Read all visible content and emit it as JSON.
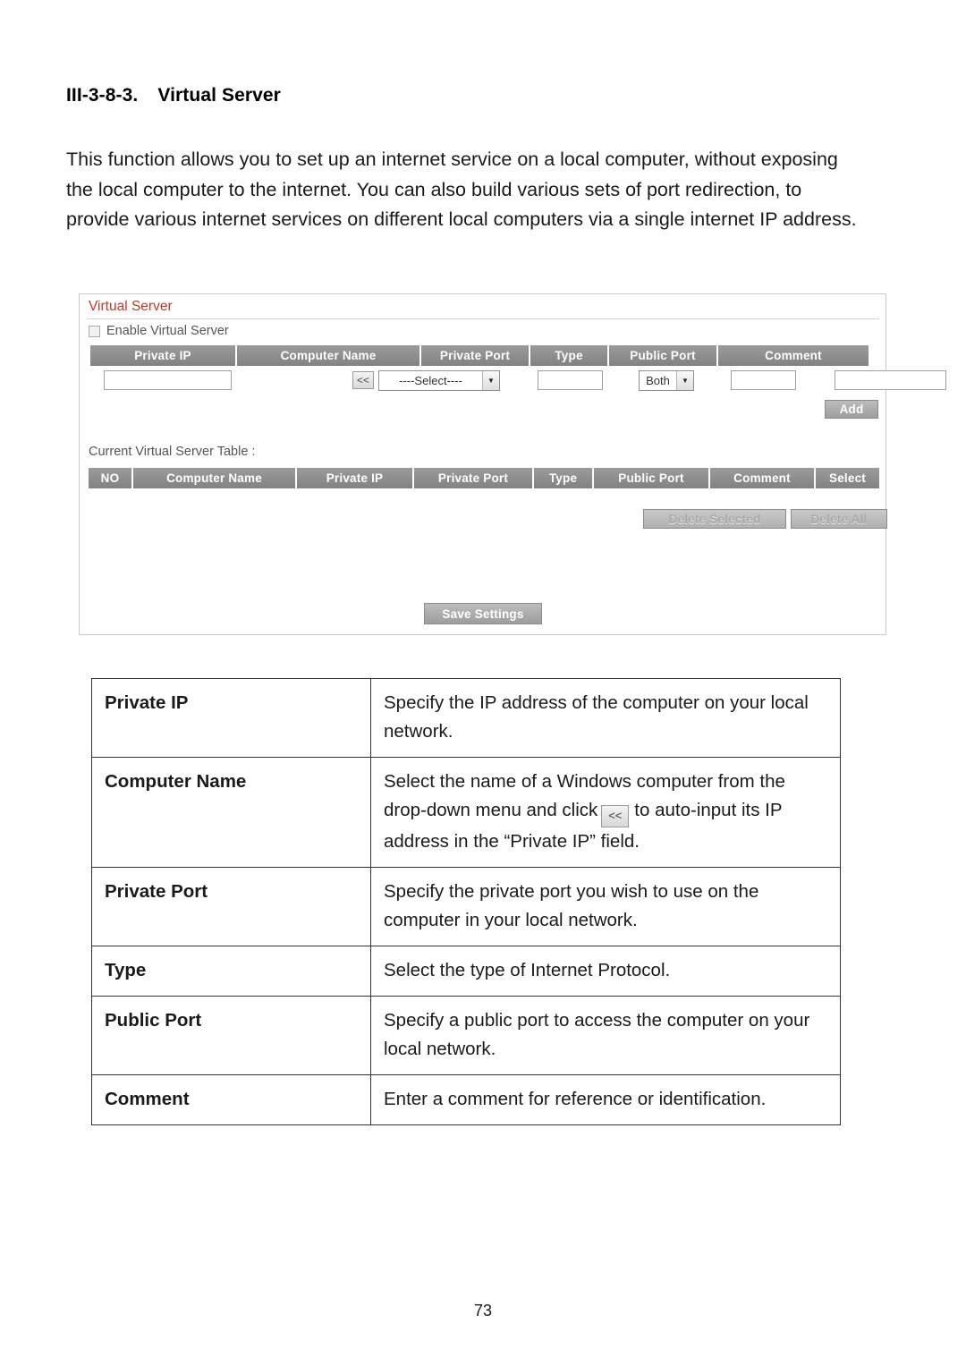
{
  "heading": {
    "number": "III-3-8-3.",
    "title": "Virtual Server"
  },
  "intro": "This function allows you to set up an internet service on a local computer, without exposing the local computer to the internet. You can also build various sets of port redirection, to provide various internet services on different local computers via a single internet IP address.",
  "ui": {
    "panel_title": "Virtual Server",
    "panel_title_color": "#c0392b",
    "enable_checkbox_label": "Enable  Virtual Server",
    "enable_checked": false,
    "entry_headers": [
      "Private IP",
      "Computer Name",
      "Private Port",
      "Type",
      "Public Port",
      "Comment"
    ],
    "fields": {
      "private_ip_value": "",
      "copy_button_label": "<<",
      "computer_name_selected": "----Select----",
      "private_port_value": "",
      "type_selected": "Both",
      "public_port_value": "",
      "comment_value": ""
    },
    "add_button_label": "Add",
    "current_table_label": "Current Virtual Server Table :",
    "table_headers": [
      "NO",
      "Computer Name",
      "Private IP",
      "Private Port",
      "Type",
      "Public Port",
      "Comment",
      "Select"
    ],
    "delete_selected_label": "Delete Selected",
    "delete_all_label": "Delete All",
    "save_settings_label": "Save Settings"
  },
  "descriptions": [
    {
      "term": "Private IP",
      "text": "Specify the IP address of the computer on your local network.",
      "has_icon": false
    },
    {
      "term": "Computer Name",
      "text_before": "Select the name of a Windows computer from the drop-down menu and click",
      "icon_label": "<<",
      "text_after": "to auto-input its IP address in the “Private IP” field.",
      "has_icon": true
    },
    {
      "term": "Private Port",
      "text": "Specify the private port you wish to use on the computer in your local network.",
      "has_icon": false
    },
    {
      "term": "Type",
      "text": "Select the type of Internet Protocol.",
      "has_icon": false
    },
    {
      "term": "Public Port",
      "text": "Specify a public port to access the computer on your local network.",
      "has_icon": false
    },
    {
      "term": "Comment",
      "text": "Enter a comment for reference or identification.",
      "has_icon": false
    }
  ],
  "page_number": "73"
}
